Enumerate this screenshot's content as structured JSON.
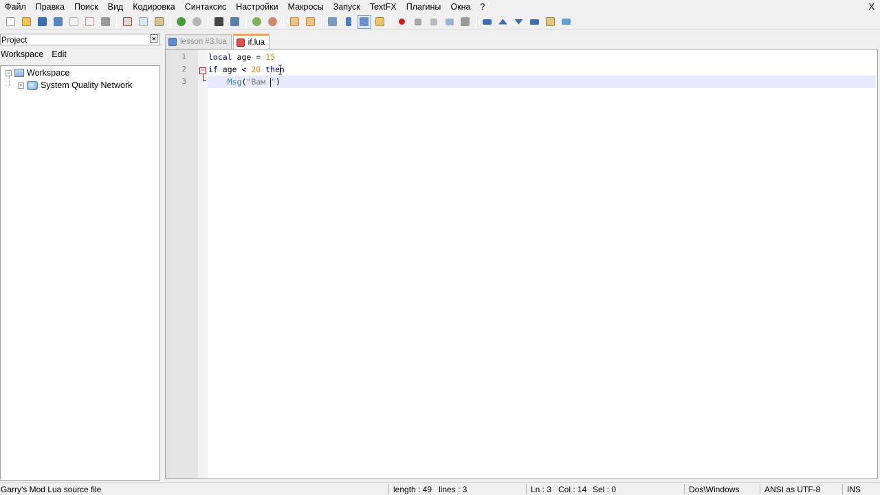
{
  "menu": [
    "Файл",
    "Правка",
    "Поиск",
    "Вид",
    "Кодировка",
    "Синтаксис",
    "Настройки",
    "Макросы",
    "Запуск",
    "TextFX",
    "Плагины",
    "Окна",
    "?"
  ],
  "window_close": "X",
  "project_panel": {
    "title": "Project",
    "close": "×",
    "menu": [
      "Workspace",
      "Edit"
    ],
    "tree": {
      "root": "Workspace",
      "child": "System Quality Network"
    }
  },
  "tabs": [
    {
      "label": "lesson #3.lua",
      "active": false
    },
    {
      "label": "if.lua",
      "active": true
    }
  ],
  "editor": {
    "line_numbers": [
      "1",
      "2",
      "3"
    ],
    "lines": {
      "l1": {
        "kw": "local",
        "mid": " age = ",
        "num": "15"
      },
      "l2": {
        "kw1": "if",
        "mid1": " age < ",
        "num": "20",
        "sp": " ",
        "kw2": "then"
      },
      "l3": {
        "indent": "    ",
        "fn": "Msg",
        "open": "(",
        "str1": "\"Вам ",
        "str2": "\"",
        "close": ")"
      }
    },
    "colors": {
      "keyword": "#00007f",
      "number": "#ff8000",
      "function": "#2f7fa6",
      "string": "#808080",
      "fold_marker": "#dd0000",
      "current_line": "#e8e8ff"
    }
  },
  "status": {
    "filetype": "Garry's Mod Lua source file",
    "length": "length : 49",
    "lines": "lines : 3",
    "ln": "Ln : 3",
    "col": "Col : 14",
    "sel": "Sel : 0",
    "eol": "Dos\\Windows",
    "encoding": "ANSI as UTF-8",
    "mode": "INS"
  },
  "toolbar_icons": [
    "new-file-icon",
    "open-file-icon",
    "save-icon",
    "save-all-icon",
    "close-icon",
    "close-all-icon",
    "print-icon",
    "cut-icon",
    "copy-icon",
    "paste-icon",
    "undo-icon",
    "redo-icon",
    "find-icon",
    "replace-icon",
    "zoom-in-icon",
    "zoom-out-icon",
    "sync-v-icon",
    "sync-h-icon",
    "word-wrap-icon",
    "show-all-chars-icon",
    "indent-guide-icon",
    "doc-map-icon",
    "record-macro-icon",
    "stop-macro-icon",
    "play-macro-icon",
    "run-macro-multiple-icon",
    "save-macro-icon",
    "collapse-icon",
    "prev-icon",
    "next-icon",
    "expand-icon",
    "explorer-icon",
    "spellcheck-icon"
  ]
}
